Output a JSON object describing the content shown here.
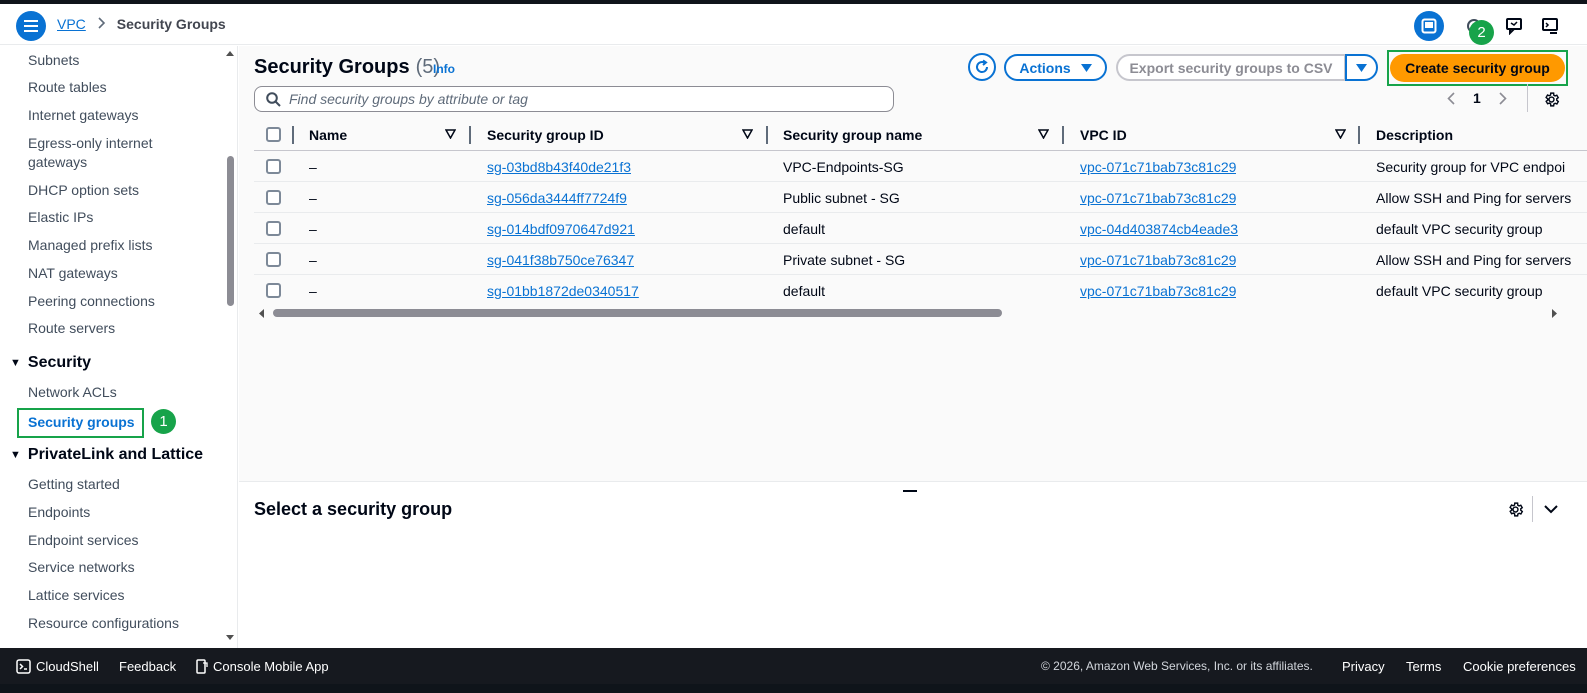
{
  "header": {
    "breadcrumb": {
      "service": "VPC",
      "separator": ">",
      "current": "Security Groups"
    }
  },
  "sidebar": {
    "items_top": [
      "Subnets",
      "Route tables",
      "Internet gateways",
      "Egress-only internet",
      "gateways",
      "DHCP option sets",
      "Elastic IPs",
      "Managed prefix lists",
      "NAT gateways",
      "Peering connections",
      "Route servers"
    ],
    "security_section": "Security",
    "security_items": [
      "Network ACLs",
      "Security groups"
    ],
    "privatelink_section": "PrivateLink and Lattice",
    "privatelink_items": [
      "Getting started",
      "Endpoints",
      "Endpoint services",
      "Service networks",
      "Lattice services",
      "Resource configurations"
    ]
  },
  "annotations": {
    "badge1": "1",
    "badge2": "2"
  },
  "main": {
    "title": "Security Groups",
    "count": "(5)",
    "info": "Info",
    "actions_label": "Actions",
    "export_label": "Export security groups to CSV",
    "create_label": "Create security group",
    "search_placeholder": "Find security groups by attribute or tag",
    "page": "1",
    "columns": [
      "Name",
      "Security group ID",
      "Security group name",
      "VPC ID",
      "Description"
    ],
    "rows": [
      {
        "name": "–",
        "sg_id": "sg-03bd8b43f40de21f3",
        "sg_name": "VPC-Endpoints-SG",
        "vpc_id": "vpc-071c71bab73c81c29",
        "description": "Security group for VPC endpoi"
      },
      {
        "name": "–",
        "sg_id": "sg-056da3444ff7724f9",
        "sg_name": "Public subnet - SG",
        "vpc_id": "vpc-071c71bab73c81c29",
        "description": "Allow SSH and Ping for servers"
      },
      {
        "name": "–",
        "sg_id": "sg-014bdf0970647d921",
        "sg_name": "default",
        "vpc_id": "vpc-04d403874cb4eade3",
        "description": "default VPC security group"
      },
      {
        "name": "–",
        "sg_id": "sg-041f38b750ce76347",
        "sg_name": "Private subnet - SG",
        "vpc_id": "vpc-071c71bab73c81c29",
        "description": "Allow SSH and Ping for servers"
      },
      {
        "name": "–",
        "sg_id": "sg-01bb1872de0340517",
        "sg_name": "default",
        "vpc_id": "vpc-071c71bab73c81c29",
        "description": "default VPC security group"
      }
    ]
  },
  "detail": {
    "title": "Select a security group"
  },
  "footer": {
    "cloudshell": "CloudShell",
    "feedback": "Feedback",
    "mobile_app": "Console Mobile App",
    "copyright": "© 2026, Amazon Web Services, Inc. or its affiliates.",
    "privacy": "Privacy",
    "terms": "Terms",
    "cookies": "Cookie preferences"
  },
  "colors": {
    "accent": "#0972d3",
    "primary_button": "#ff9900",
    "annotation": "#17a34a",
    "footer_bg": "#16191f"
  },
  "icons": [
    "menu-icon",
    "chevron-right-icon",
    "panel-icon",
    "notifications-icon",
    "feedback-icon",
    "cloudshell-header-icon",
    "refresh-icon",
    "caret-down-icon",
    "search-icon",
    "settings-icon",
    "sort-icon",
    "scroll-arrow-icon",
    "chevron-down-icon"
  ]
}
